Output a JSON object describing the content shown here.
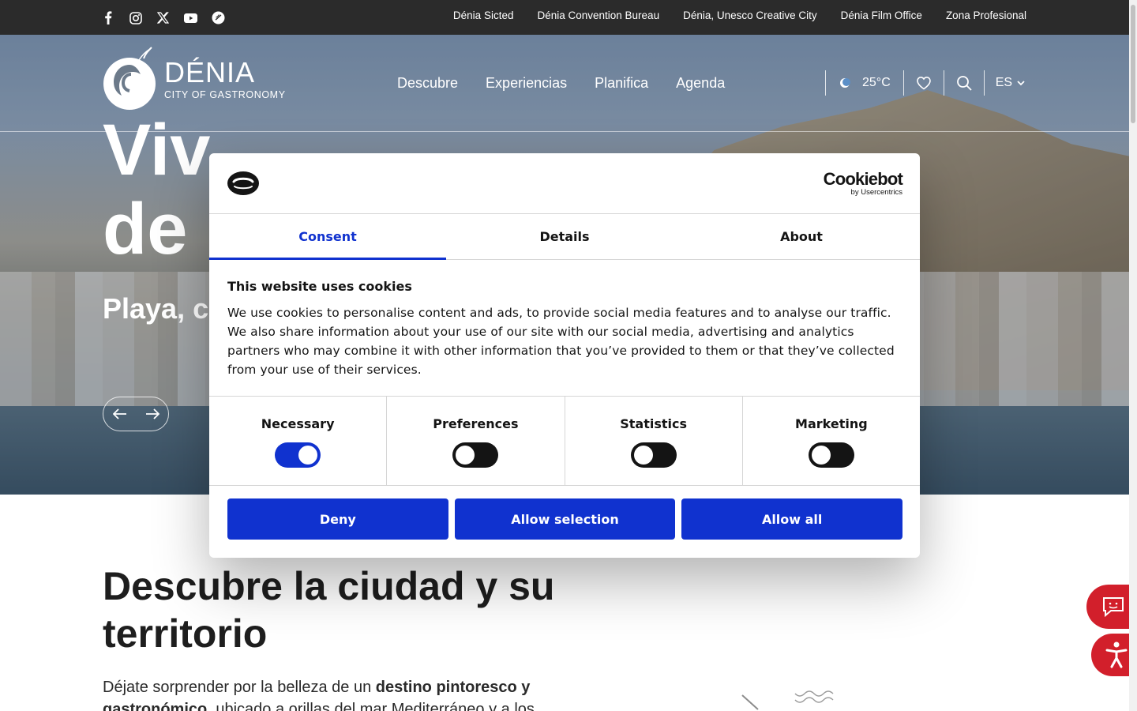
{
  "topbar": {
    "social_icons": [
      "facebook-icon",
      "instagram-icon",
      "x-icon",
      "youtube-icon",
      "tiktok-icon"
    ],
    "links": [
      "Dénia Sicted",
      "Dénia Convention Bureau",
      "Dénia, Unesco Creative City",
      "Dénia Film Office",
      "Zona Profesional"
    ]
  },
  "header": {
    "logo_title": "DÉNIA",
    "logo_subtitle": "CITY OF GASTRONOMY",
    "nav": [
      "Descubre",
      "Experiencias",
      "Planifica",
      "Agenda"
    ],
    "temperature": "25°C",
    "language": "ES"
  },
  "hero": {
    "title_line1": "Viv",
    "title_line2": "de",
    "subtitle": "Playa, cu"
  },
  "content": {
    "title": "Descubre la ciudad y su territorio",
    "text_start": "Déjate sorprender por la belleza de un ",
    "text_bold": "destino pintoresco y gastronómico",
    "text_end": ", ubicado a orillas del mar Mediterráneo y a los"
  },
  "cookie_dialog": {
    "brand": "Cookiebot",
    "brand_sub": "by Usercentrics",
    "tabs": [
      "Consent",
      "Details",
      "About"
    ],
    "active_tab": "Consent",
    "heading": "This website uses cookies",
    "body": "We use cookies to personalise content and ads, to provide social media features and to analyse our traffic. We also share information about your use of our site with our social media, advertising and analytics partners who may combine it with other information that you’ve provided to them or that they’ve collected from your use of their services.",
    "categories": [
      {
        "label": "Necessary",
        "enabled": true
      },
      {
        "label": "Preferences",
        "enabled": false
      },
      {
        "label": "Statistics",
        "enabled": false
      },
      {
        "label": "Marketing",
        "enabled": false
      }
    ],
    "buttons": {
      "deny": "Deny",
      "selection": "Allow selection",
      "all": "Allow all"
    }
  },
  "colors": {
    "primary_blue": "#1032cf",
    "topbar_bg": "#2b2b2b",
    "accent_red": "#d21f2b"
  }
}
